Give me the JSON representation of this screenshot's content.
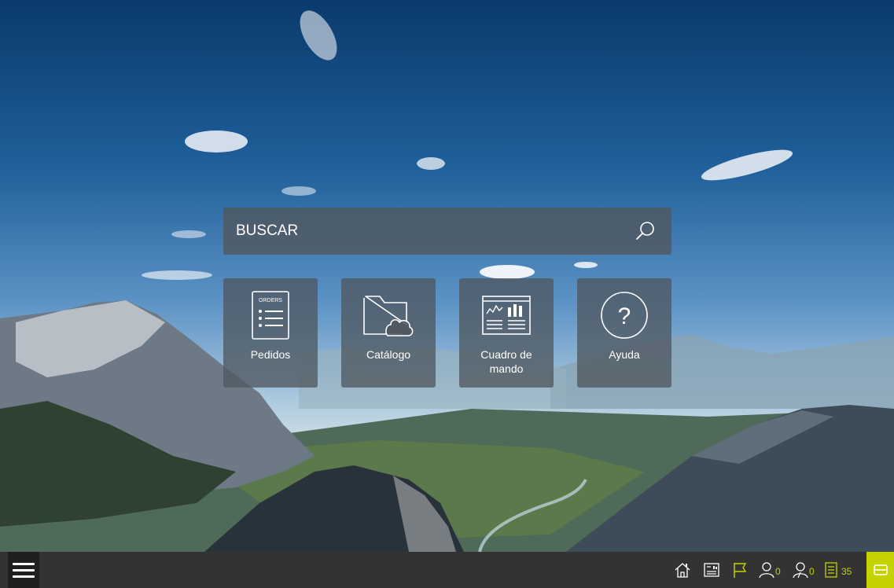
{
  "search": {
    "placeholder": "BUSCAR"
  },
  "tiles": [
    {
      "label": "Pedidos",
      "icon": "orders-document-icon",
      "icon_text": "ORDERS"
    },
    {
      "label": "Catálogo",
      "icon": "folder-cloud-icon"
    },
    {
      "label": "Cuadro de mando",
      "icon": "dashboard-chart-icon"
    },
    {
      "label": "Ayuda",
      "icon": "help-circle-icon"
    }
  ],
  "taskbar": {
    "menu_icon": "hamburger-menu-icon",
    "icons": [
      {
        "name": "home-icon"
      },
      {
        "name": "report-icon"
      },
      {
        "name": "flag-icon"
      },
      {
        "name": "user-icon",
        "count": "0"
      },
      {
        "name": "users-icon",
        "count": "0"
      },
      {
        "name": "list-icon",
        "count": "35"
      }
    ],
    "accent_icon": "card-icon"
  },
  "colors": {
    "accent": "#c4d200",
    "taskbar": "#333333",
    "tile_bg": "rgba(80,88,96,0.78)"
  }
}
